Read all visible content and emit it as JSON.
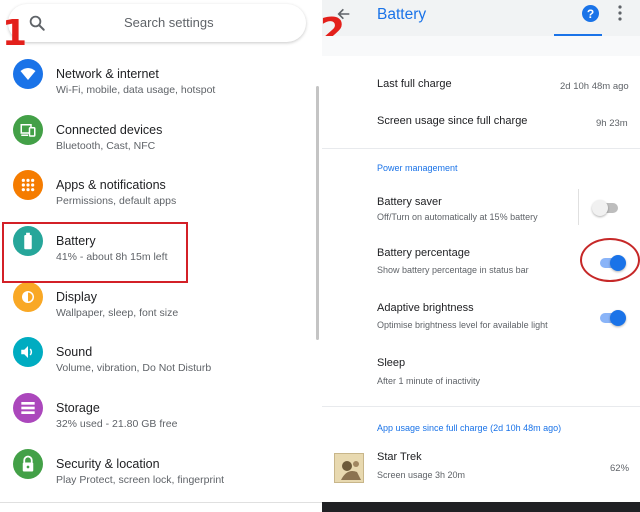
{
  "annotations": {
    "step1": "1",
    "step2": "2"
  },
  "left": {
    "search": {
      "placeholder": "Search settings"
    },
    "items": [
      {
        "title": "Network & internet",
        "subtitle": "Wi-Fi, mobile, data usage, hotspot",
        "icon": "wifi-icon",
        "color": "#1a73e8"
      },
      {
        "title": "Connected devices",
        "subtitle": "Bluetooth, Cast, NFC",
        "icon": "devices-icon",
        "color": "#43a047"
      },
      {
        "title": "Apps & notifications",
        "subtitle": "Permissions, default apps",
        "icon": "apps-icon",
        "color": "#f57c00"
      },
      {
        "title": "Battery",
        "subtitle": "41% - about 8h 15m left",
        "icon": "battery-icon",
        "color": "#26a69a"
      },
      {
        "title": "Display",
        "subtitle": "Wallpaper, sleep, font size",
        "icon": "brightness-icon",
        "color": "#f9a825"
      },
      {
        "title": "Sound",
        "subtitle": "Volume, vibration, Do Not Disturb",
        "icon": "volume-icon",
        "color": "#00acc1"
      },
      {
        "title": "Storage",
        "subtitle": "32% used - 21.80 GB free",
        "icon": "storage-icon",
        "color": "#ab47bc"
      },
      {
        "title": "Security & location",
        "subtitle": "Play Protect, screen lock, fingerprint",
        "icon": "lock-icon",
        "color": "#43a047"
      }
    ]
  },
  "right": {
    "title": "Battery",
    "help_icon": "?",
    "last_full_charge": {
      "label": "Last full charge",
      "value": "2d 10h 48m ago"
    },
    "screen_usage": {
      "label": "Screen usage since full charge",
      "value": "9h 23m"
    },
    "power_management_header": "Power management",
    "battery_saver": {
      "title": "Battery saver",
      "subtitle": "Off/Turn on automatically at 15% battery",
      "enabled": false
    },
    "battery_percentage": {
      "title": "Battery percentage",
      "subtitle": "Show battery percentage in status bar",
      "enabled": true
    },
    "adaptive_brightness": {
      "title": "Adaptive brightness",
      "subtitle": "Optimise brightness level for available light",
      "enabled": true
    },
    "sleep": {
      "title": "Sleep",
      "subtitle": "After 1 minute of inactivity"
    },
    "app_usage_header": "App usage since full charge (2d 10h 48m ago)",
    "apps": [
      {
        "name": "Star Trek",
        "usage": "Screen usage 3h 20m",
        "percent": "62%"
      }
    ],
    "accent_color": "#1a73e8"
  }
}
